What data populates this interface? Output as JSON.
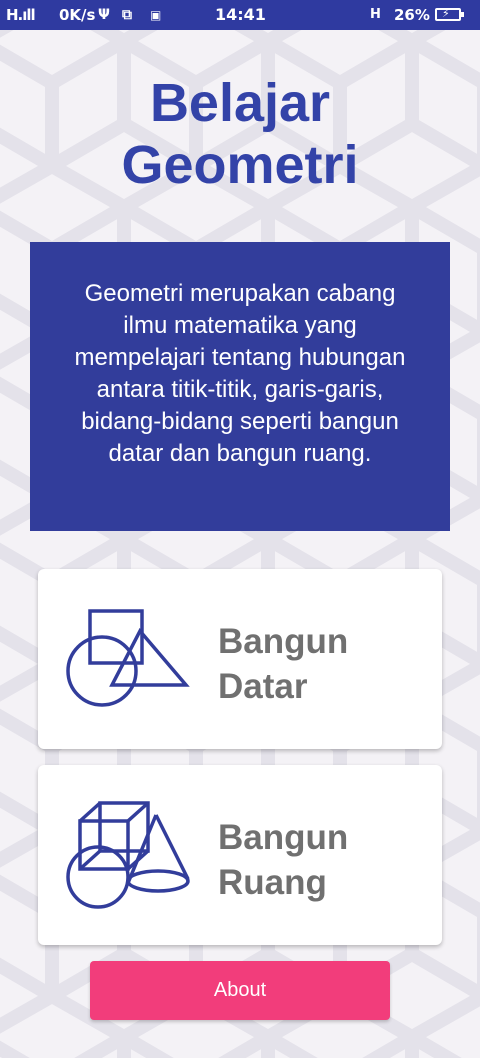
{
  "status_bar": {
    "signal": "H.ıll",
    "speed": "0K/s",
    "usb_icon": "usb-icon",
    "screenshot_icon": "screenshot-icon",
    "time": "14:41",
    "network_type": "H",
    "battery": "26%",
    "battery_icon": "battery-charging-icon"
  },
  "header": {
    "title_line1": "Belajar",
    "title_line2": "Geometri"
  },
  "description": "Geometri merupakan cabang ilmu matematika yang mempelajari tentang hubungan antara titik-titik, garis-garis, bidang-bidang seperti bangun datar dan bangun ruang.",
  "cards": [
    {
      "label_line1": "Bangun",
      "label_line2": "Datar",
      "icon": "flat-shapes-icon"
    },
    {
      "label_line1": "Bangun",
      "label_line2": "Ruang",
      "icon": "solid-shapes-icon"
    }
  ],
  "about_button": "About",
  "colors": {
    "primary": "#323d9b",
    "title": "#3343a8",
    "accent": "#f23d7b",
    "card_text": "#707070",
    "background": "#f4f2f6"
  }
}
